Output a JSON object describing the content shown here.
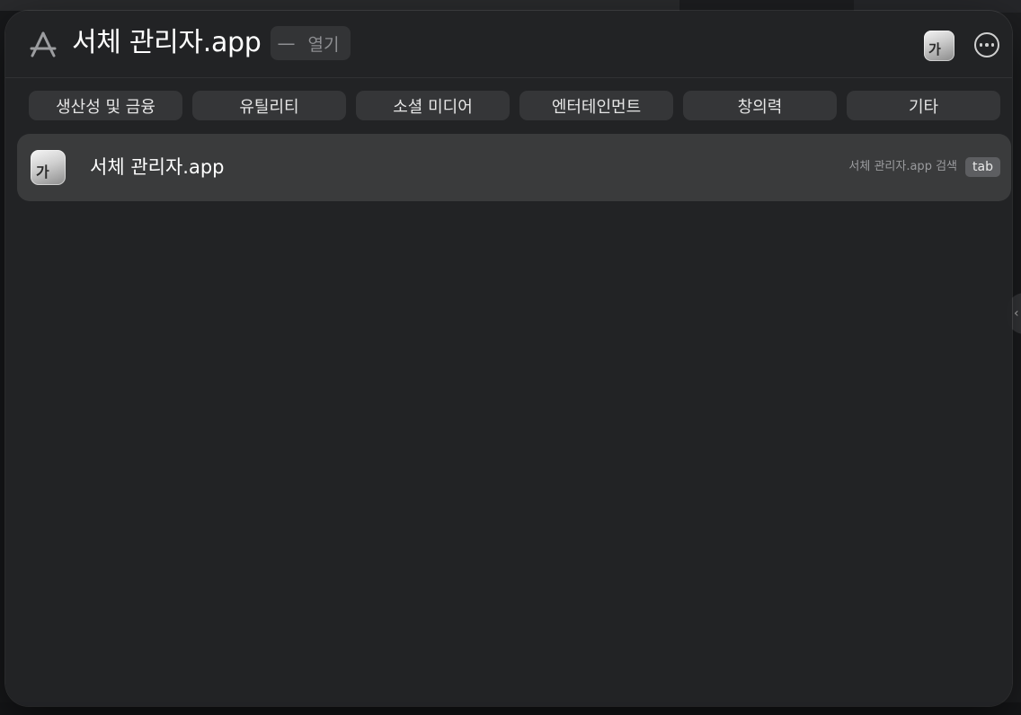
{
  "search": {
    "query": "서체 관리자.app",
    "suffix_dash": "—",
    "suffix_action": "열기"
  },
  "header": {
    "left_icon": "app-store-icon",
    "app_icon_glyph": "가",
    "more_icon": "ellipsis-circle-icon"
  },
  "categories": [
    {
      "label": "생산성 및 금융"
    },
    {
      "label": "유틸리티"
    },
    {
      "label": "소셜 미디어"
    },
    {
      "label": "엔터테인먼트"
    },
    {
      "label": "창의력"
    },
    {
      "label": "기타"
    }
  ],
  "results": [
    {
      "icon_glyph": "가",
      "title": "서체 관리자.app",
      "hint": "서체 관리자.app 검색",
      "key": "tab"
    }
  ]
}
